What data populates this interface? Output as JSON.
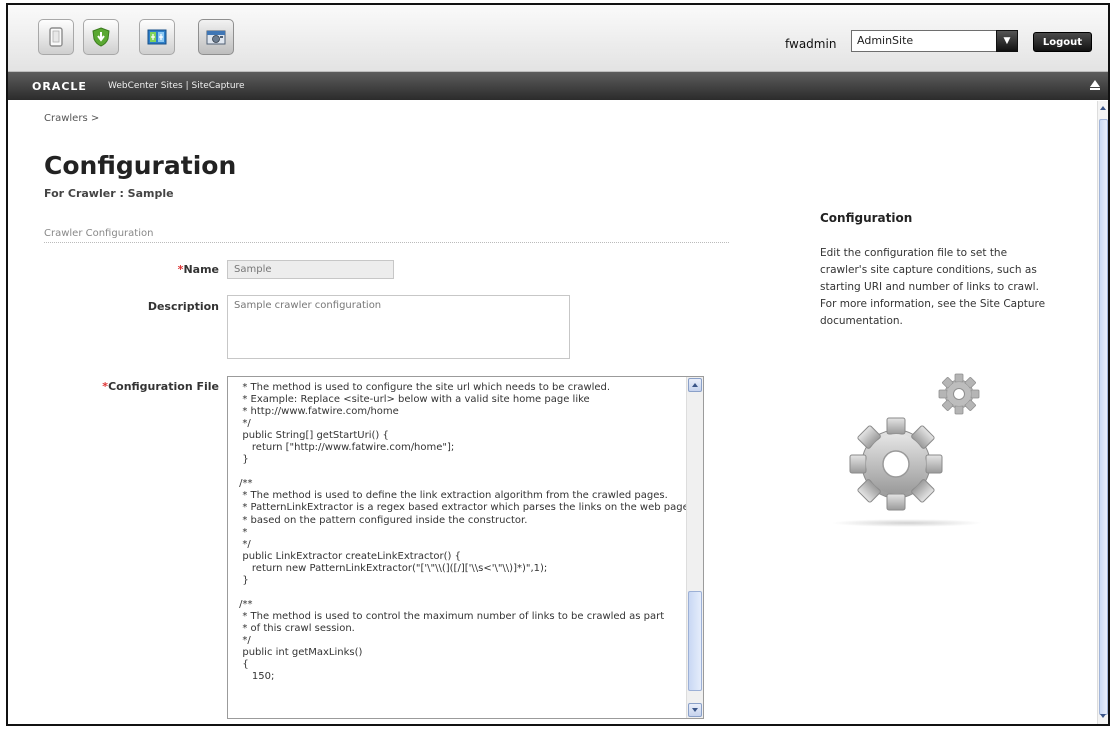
{
  "toolbar": {
    "buttons": [
      {
        "icon": "blank-page-icon"
      },
      {
        "icon": "shield-download-icon"
      },
      {
        "icon": "dashboard-icon"
      },
      {
        "icon": "camera-icon",
        "active": true
      }
    ],
    "user": "fwadmin",
    "site_select": {
      "value": "AdminSite"
    },
    "logout_label": "Logout"
  },
  "brand": {
    "oracle": "ORACLE",
    "product": "WebCenter Sites | SiteCapture"
  },
  "breadcrumb": "Crawlers >",
  "page": {
    "title": "Configuration",
    "subtitle": "For Crawler : Sample"
  },
  "form": {
    "section_label": "Crawler Configuration",
    "name_label": "Name",
    "name_value": "Sample",
    "description_label": "Description",
    "description_value": "Sample crawler configuration",
    "config_label": "Configuration File",
    "config_text": "  * The method is used to configure the site url which needs to be crawled.\n  * Example: Replace <site-url> below with a valid site home page like\n  * http://www.fatwire.com/home\n  */\n  public String[] getStartUri() {\n     return [\"http://www.fatwire.com/home\"];\n  }\n\n /**\n  * The method is used to define the link extraction algorithm from the crawled pages.\n  * PatternLinkExtractor is a regex based extractor which parses the links on the web page\n  * based on the pattern configured inside the constructor.\n  *\n  */\n  public LinkExtractor createLinkExtractor() {\n     return new PatternLinkExtractor(\"['\\\"\\\\(]([/]['\\\\s<'\\\"\\\\)]*)\",1);\n  }\n\n /**\n  * The method is used to control the maximum number of links to be crawled as part\n  * of this crawl session.\n  */\n  public int getMaxLinks()\n  {\n     150;"
  },
  "help": {
    "title": "Configuration",
    "text": "Edit the configuration file to set the crawler's site capture conditions, such as starting URI and number of links to crawl. For more information, see the Site Capture documentation."
  },
  "colors": {
    "toolbar_bg": "#eeeeee",
    "brandbar_bg": "#3d3d3d",
    "required": "#d33333",
    "scroll_thumb": "#d6e2f7"
  }
}
